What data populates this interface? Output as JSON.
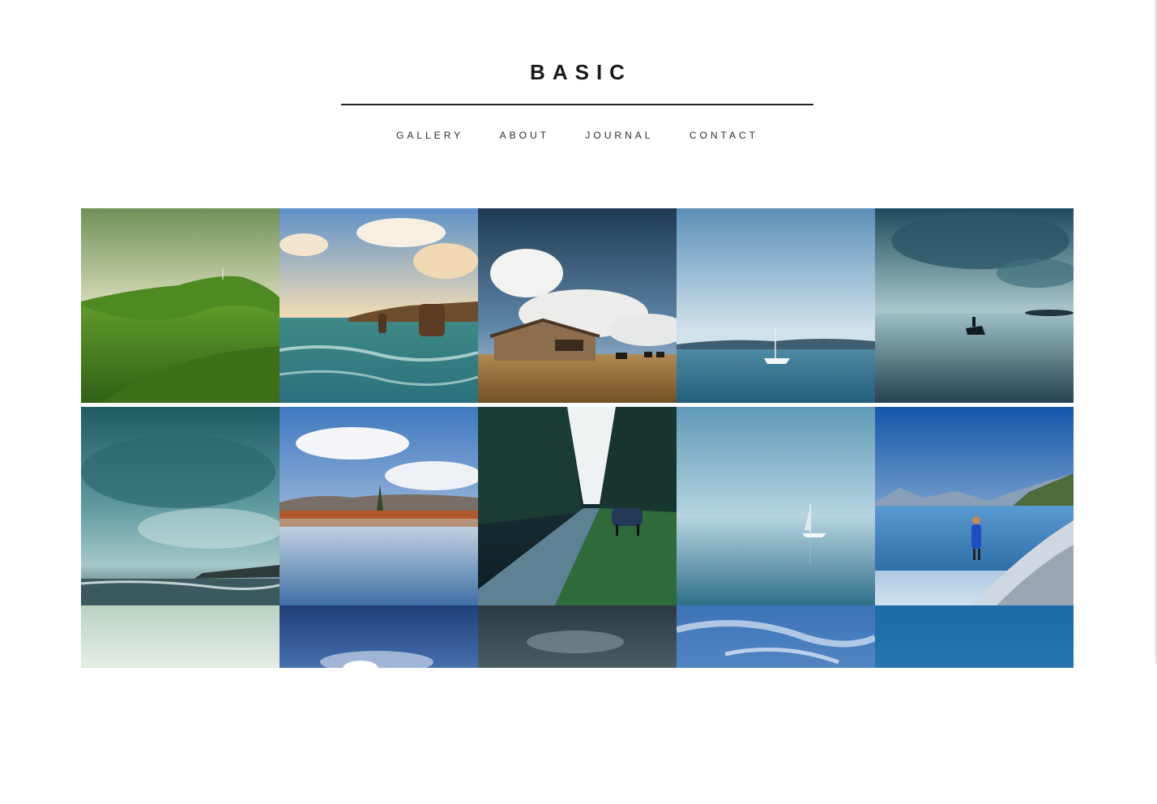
{
  "site": {
    "title": "BASIC"
  },
  "nav": {
    "items": [
      {
        "label": "GALLERY"
      },
      {
        "label": "ABOUT"
      },
      {
        "label": "JOURNAL"
      },
      {
        "label": "CONTACT"
      }
    ]
  },
  "gallery": {
    "photos": [
      {
        "subject": "green-hills"
      },
      {
        "subject": "sea-stacks-coast"
      },
      {
        "subject": "wooden-shed-cows"
      },
      {
        "subject": "sailboat-calm-lake"
      },
      {
        "subject": "horse-rider-beach"
      },
      {
        "subject": "stormy-coast"
      },
      {
        "subject": "lake-autumn-reflection"
      },
      {
        "subject": "forest-road-horse"
      },
      {
        "subject": "misty-sailboat"
      },
      {
        "subject": "woman-frosty-shore"
      },
      {
        "subject": "pale-green-sky"
      },
      {
        "subject": "blue-sky-clouds"
      },
      {
        "subject": "dark-storm-clouds"
      },
      {
        "subject": "blue-sky-streaks"
      },
      {
        "subject": "deep-blue-sky"
      }
    ]
  }
}
